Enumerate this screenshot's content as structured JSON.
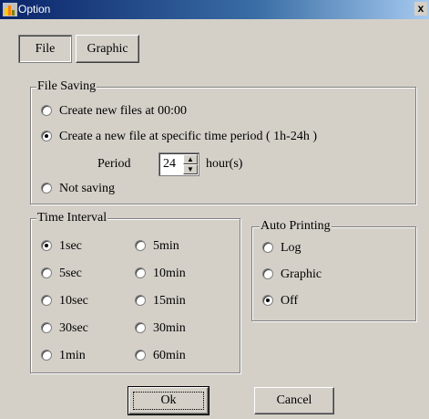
{
  "window": {
    "title": "Option",
    "close_glyph": "x"
  },
  "tabs": [
    {
      "label": "File",
      "active": true
    },
    {
      "label": "Graphic",
      "active": false
    }
  ],
  "file_saving": {
    "legend": "File Saving",
    "options": [
      {
        "label": "Create new files at 00:00",
        "checked": false
      },
      {
        "label": "Create a new file at specific time period ( 1h-24h )",
        "checked": true
      },
      {
        "label": "Not saving",
        "checked": false
      }
    ],
    "period_label": "Period",
    "period_value": "24",
    "period_unit": "hour(s)"
  },
  "time_interval": {
    "legend": "Time Interval",
    "options": [
      {
        "label": "1sec",
        "checked": true
      },
      {
        "label": "5min",
        "checked": false
      },
      {
        "label": "5sec",
        "checked": false
      },
      {
        "label": "10min",
        "checked": false
      },
      {
        "label": "10sec",
        "checked": false
      },
      {
        "label": "15min",
        "checked": false
      },
      {
        "label": "30sec",
        "checked": false
      },
      {
        "label": "30min",
        "checked": false
      },
      {
        "label": "1min",
        "checked": false
      },
      {
        "label": "60min",
        "checked": false
      }
    ]
  },
  "auto_printing": {
    "legend": "Auto Printing",
    "options": [
      {
        "label": "Log",
        "checked": false
      },
      {
        "label": "Graphic",
        "checked": false
      },
      {
        "label": "Off",
        "checked": true
      }
    ]
  },
  "buttons": {
    "ok": "Ok",
    "cancel": "Cancel"
  },
  "icons": {
    "app": "chart-app-icon",
    "close": "close-icon"
  }
}
